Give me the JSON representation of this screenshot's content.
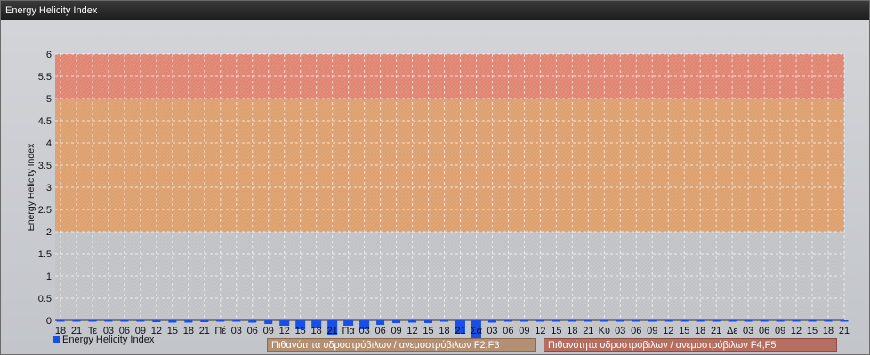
{
  "window": {
    "title": "Energy Helicity Index"
  },
  "colors": {
    "zone_low": "#c0c2c6",
    "zone_mid": "#dda06e",
    "zone_high": "#e08572",
    "bar": "#1a4fe6",
    "grid": "#ffffff"
  },
  "chart_data": {
    "type": "bar",
    "ylabel": "Energy Helicity Index",
    "ylim": [
      0,
      6
    ],
    "y_ticks": [
      "0",
      "0.5",
      "1",
      "1.5",
      "2",
      "2.5",
      "3",
      "3.5",
      "4",
      "4.5",
      "5",
      "5.5",
      "6"
    ],
    "zones": [
      {
        "from": 0,
        "to": 2,
        "color": "#c0c2c6"
      },
      {
        "from": 2,
        "to": 5,
        "color": "#dda06e"
      },
      {
        "from": 5,
        "to": 6,
        "color": "#e08572"
      }
    ],
    "categories": [
      "18",
      "21",
      "Τε",
      "03",
      "06",
      "09",
      "12",
      "15",
      "18",
      "21",
      "Πέ",
      "03",
      "06",
      "09",
      "12",
      "15",
      "18",
      "21",
      "Πα",
      "03",
      "06",
      "09",
      "12",
      "15",
      "18",
      "21",
      "Σά",
      "03",
      "06",
      "09",
      "12",
      "15",
      "18",
      "21",
      "Κυ",
      "03",
      "06",
      "09",
      "12",
      "15",
      "18",
      "21",
      "Δε",
      "03",
      "06",
      "09",
      "12",
      "15",
      "18",
      "21"
    ],
    "series": [
      {
        "name": "Energy Helicity Index",
        "values": [
          -0.03,
          -0.03,
          -0.03,
          -0.03,
          -0.03,
          -0.03,
          -0.04,
          -0.05,
          -0.05,
          -0.04,
          -0.03,
          -0.03,
          -0.05,
          -0.08,
          -0.12,
          -0.2,
          -0.18,
          -0.33,
          -0.12,
          -0.2,
          -0.1,
          -0.06,
          -0.05,
          -0.06,
          -0.03,
          -0.3,
          -0.6,
          -0.05,
          -0.03,
          -0.03,
          -0.03,
          -0.03,
          -0.03,
          -0.03,
          -0.03,
          -0.03,
          -0.03,
          -0.03,
          -0.03,
          -0.03,
          -0.03,
          -0.03,
          -0.03,
          -0.03,
          -0.03,
          -0.03,
          -0.03,
          -0.03,
          -0.03,
          -0.03
        ]
      }
    ]
  },
  "legend": {
    "series_label": "Energy Helicity Index"
  },
  "bands": {
    "f2f3": "Πιθανότητα υδροστρόβιλων / ανεμοστρόβιλων F2,F3",
    "f4f5": "Πιθανότητα υδροστρόβιλων / ανεμοστρόβιλων F4,F5"
  }
}
